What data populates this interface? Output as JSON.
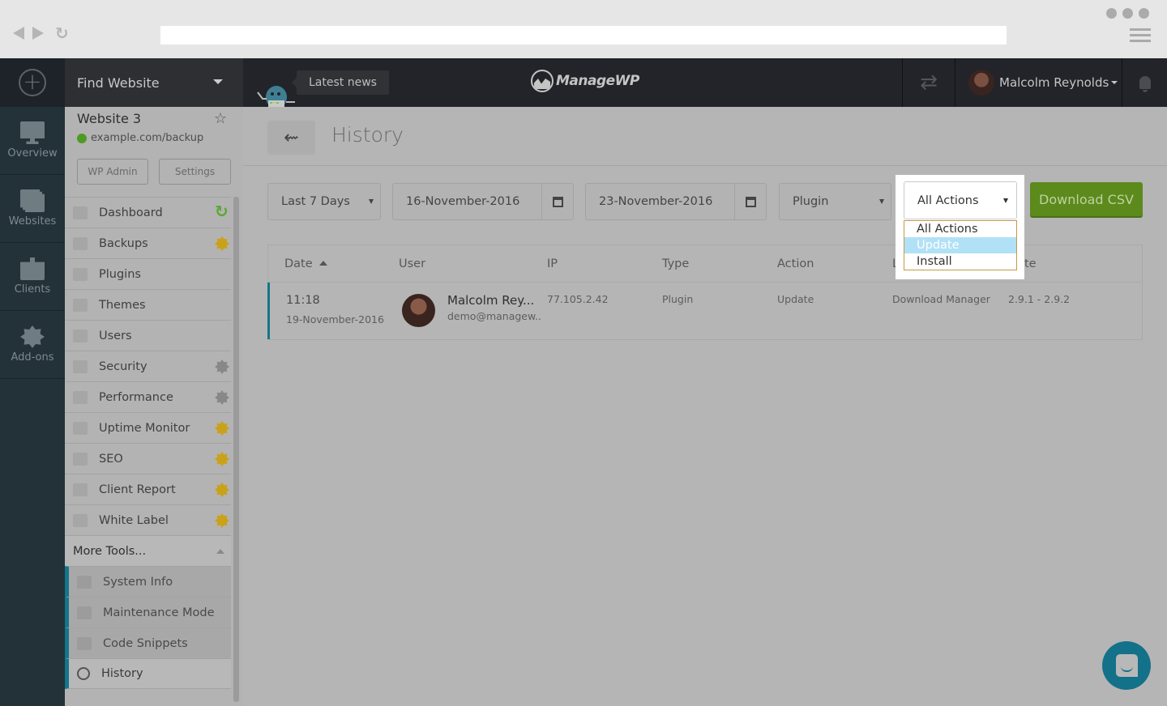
{
  "browser": {
    "back_icon": "triangle-left",
    "forward_icon": "triangle-right",
    "reload_icon": "reload",
    "url": ""
  },
  "topbar": {
    "add_icon": "plus-circle",
    "find_website_label": "Find Website",
    "news_label": "Latest news",
    "brand_name": "ManageWP",
    "sync_icon": "sync-arrows",
    "user_name": "Malcolm Reynolds",
    "bell_icon": "bell"
  },
  "rail": {
    "items": [
      {
        "label": "Overview",
        "icon": "monitor-chart"
      },
      {
        "label": "Websites",
        "icon": "stacked-pages"
      },
      {
        "label": "Clients",
        "icon": "id-badge"
      },
      {
        "label": "Add-ons",
        "icon": "star-badge"
      }
    ]
  },
  "site": {
    "name": "Website 3",
    "url": "example.com/backup",
    "wp_admin_label": "WP Admin",
    "settings_label": "Settings"
  },
  "menu": {
    "items": [
      {
        "label": "Dashboard",
        "badge": "sync"
      },
      {
        "label": "Backups",
        "badge": "gold"
      },
      {
        "label": "Plugins",
        "badge": ""
      },
      {
        "label": "Themes",
        "badge": ""
      },
      {
        "label": "Users",
        "badge": ""
      },
      {
        "label": "Security",
        "badge": "grey"
      },
      {
        "label": "Performance",
        "badge": "grey"
      },
      {
        "label": "Uptime Monitor",
        "badge": "gold"
      },
      {
        "label": "SEO",
        "badge": "gold"
      },
      {
        "label": "Client Report",
        "badge": "gold"
      },
      {
        "label": "White Label",
        "badge": "gold"
      }
    ],
    "more_tools_label": "More Tools...",
    "sub_items": [
      {
        "label": "System Info"
      },
      {
        "label": "Maintenance Mode"
      },
      {
        "label": "Code Snippets"
      },
      {
        "label": "History",
        "active": true
      }
    ]
  },
  "page": {
    "title": "History",
    "back_icon": "arrow-left"
  },
  "filters": {
    "range": "Last 7 Days",
    "date_from": "16-November-2016",
    "date_to": "23-November-2016",
    "type": "Plugin",
    "action": "All Actions",
    "action_options": [
      "All Actions",
      "Update",
      "Install"
    ],
    "action_highlighted": "Update",
    "download_label": "Download CSV"
  },
  "table": {
    "columns": [
      "Date",
      "User",
      "IP",
      "Type",
      "Action",
      "La",
      "cte"
    ],
    "rows": [
      {
        "time": "11:18",
        "date": "19-November-2016",
        "user_name": "Malcolm Rey...",
        "user_email": "demo@managew..",
        "ip": "77.105.2.42",
        "type": "Plugin",
        "action": "Update",
        "label": "Download Manager",
        "version": "2.9.1 - 2.9.2"
      }
    ]
  },
  "chat": {
    "icon": "chat-bubble"
  },
  "colors": {
    "accent_teal": "#13768a",
    "download_green": "#5c8a1c",
    "highlight_blue": "#b1e1f6",
    "badge_gold": "#c9a21a",
    "sync_green": "#5aa832"
  }
}
